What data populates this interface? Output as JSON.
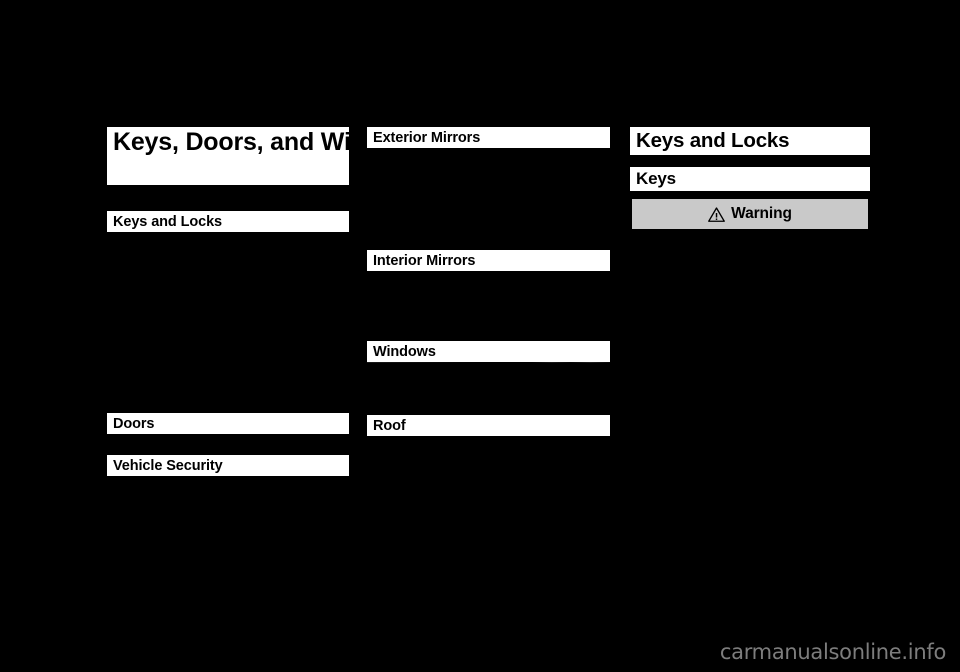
{
  "page": {
    "background_color": "#000000",
    "bar_color": "#ffffff",
    "text_color": "#000000"
  },
  "chapter": {
    "title": "Keys, Doors, and Windows"
  },
  "columns": {
    "left": {
      "entries": [
        {
          "label": "Keys and Locks"
        },
        {
          "label": "Doors"
        },
        {
          "label": "Vehicle Security"
        }
      ]
    },
    "middle": {
      "entries": [
        {
          "label": "Exterior Mirrors"
        },
        {
          "label": "Interior Mirrors"
        },
        {
          "label": "Windows"
        },
        {
          "label": "Roof"
        }
      ]
    },
    "right": {
      "section_title": "Keys and Locks",
      "subsection_title": "Keys",
      "warning": {
        "icon": "warning-triangle-icon",
        "label": "Warning",
        "background_color": "#c9c9c9",
        "border_color": "#000000"
      }
    }
  },
  "footer": {
    "watermark": "carmanualsonline.info",
    "watermark_color": "#7d7d7d"
  }
}
